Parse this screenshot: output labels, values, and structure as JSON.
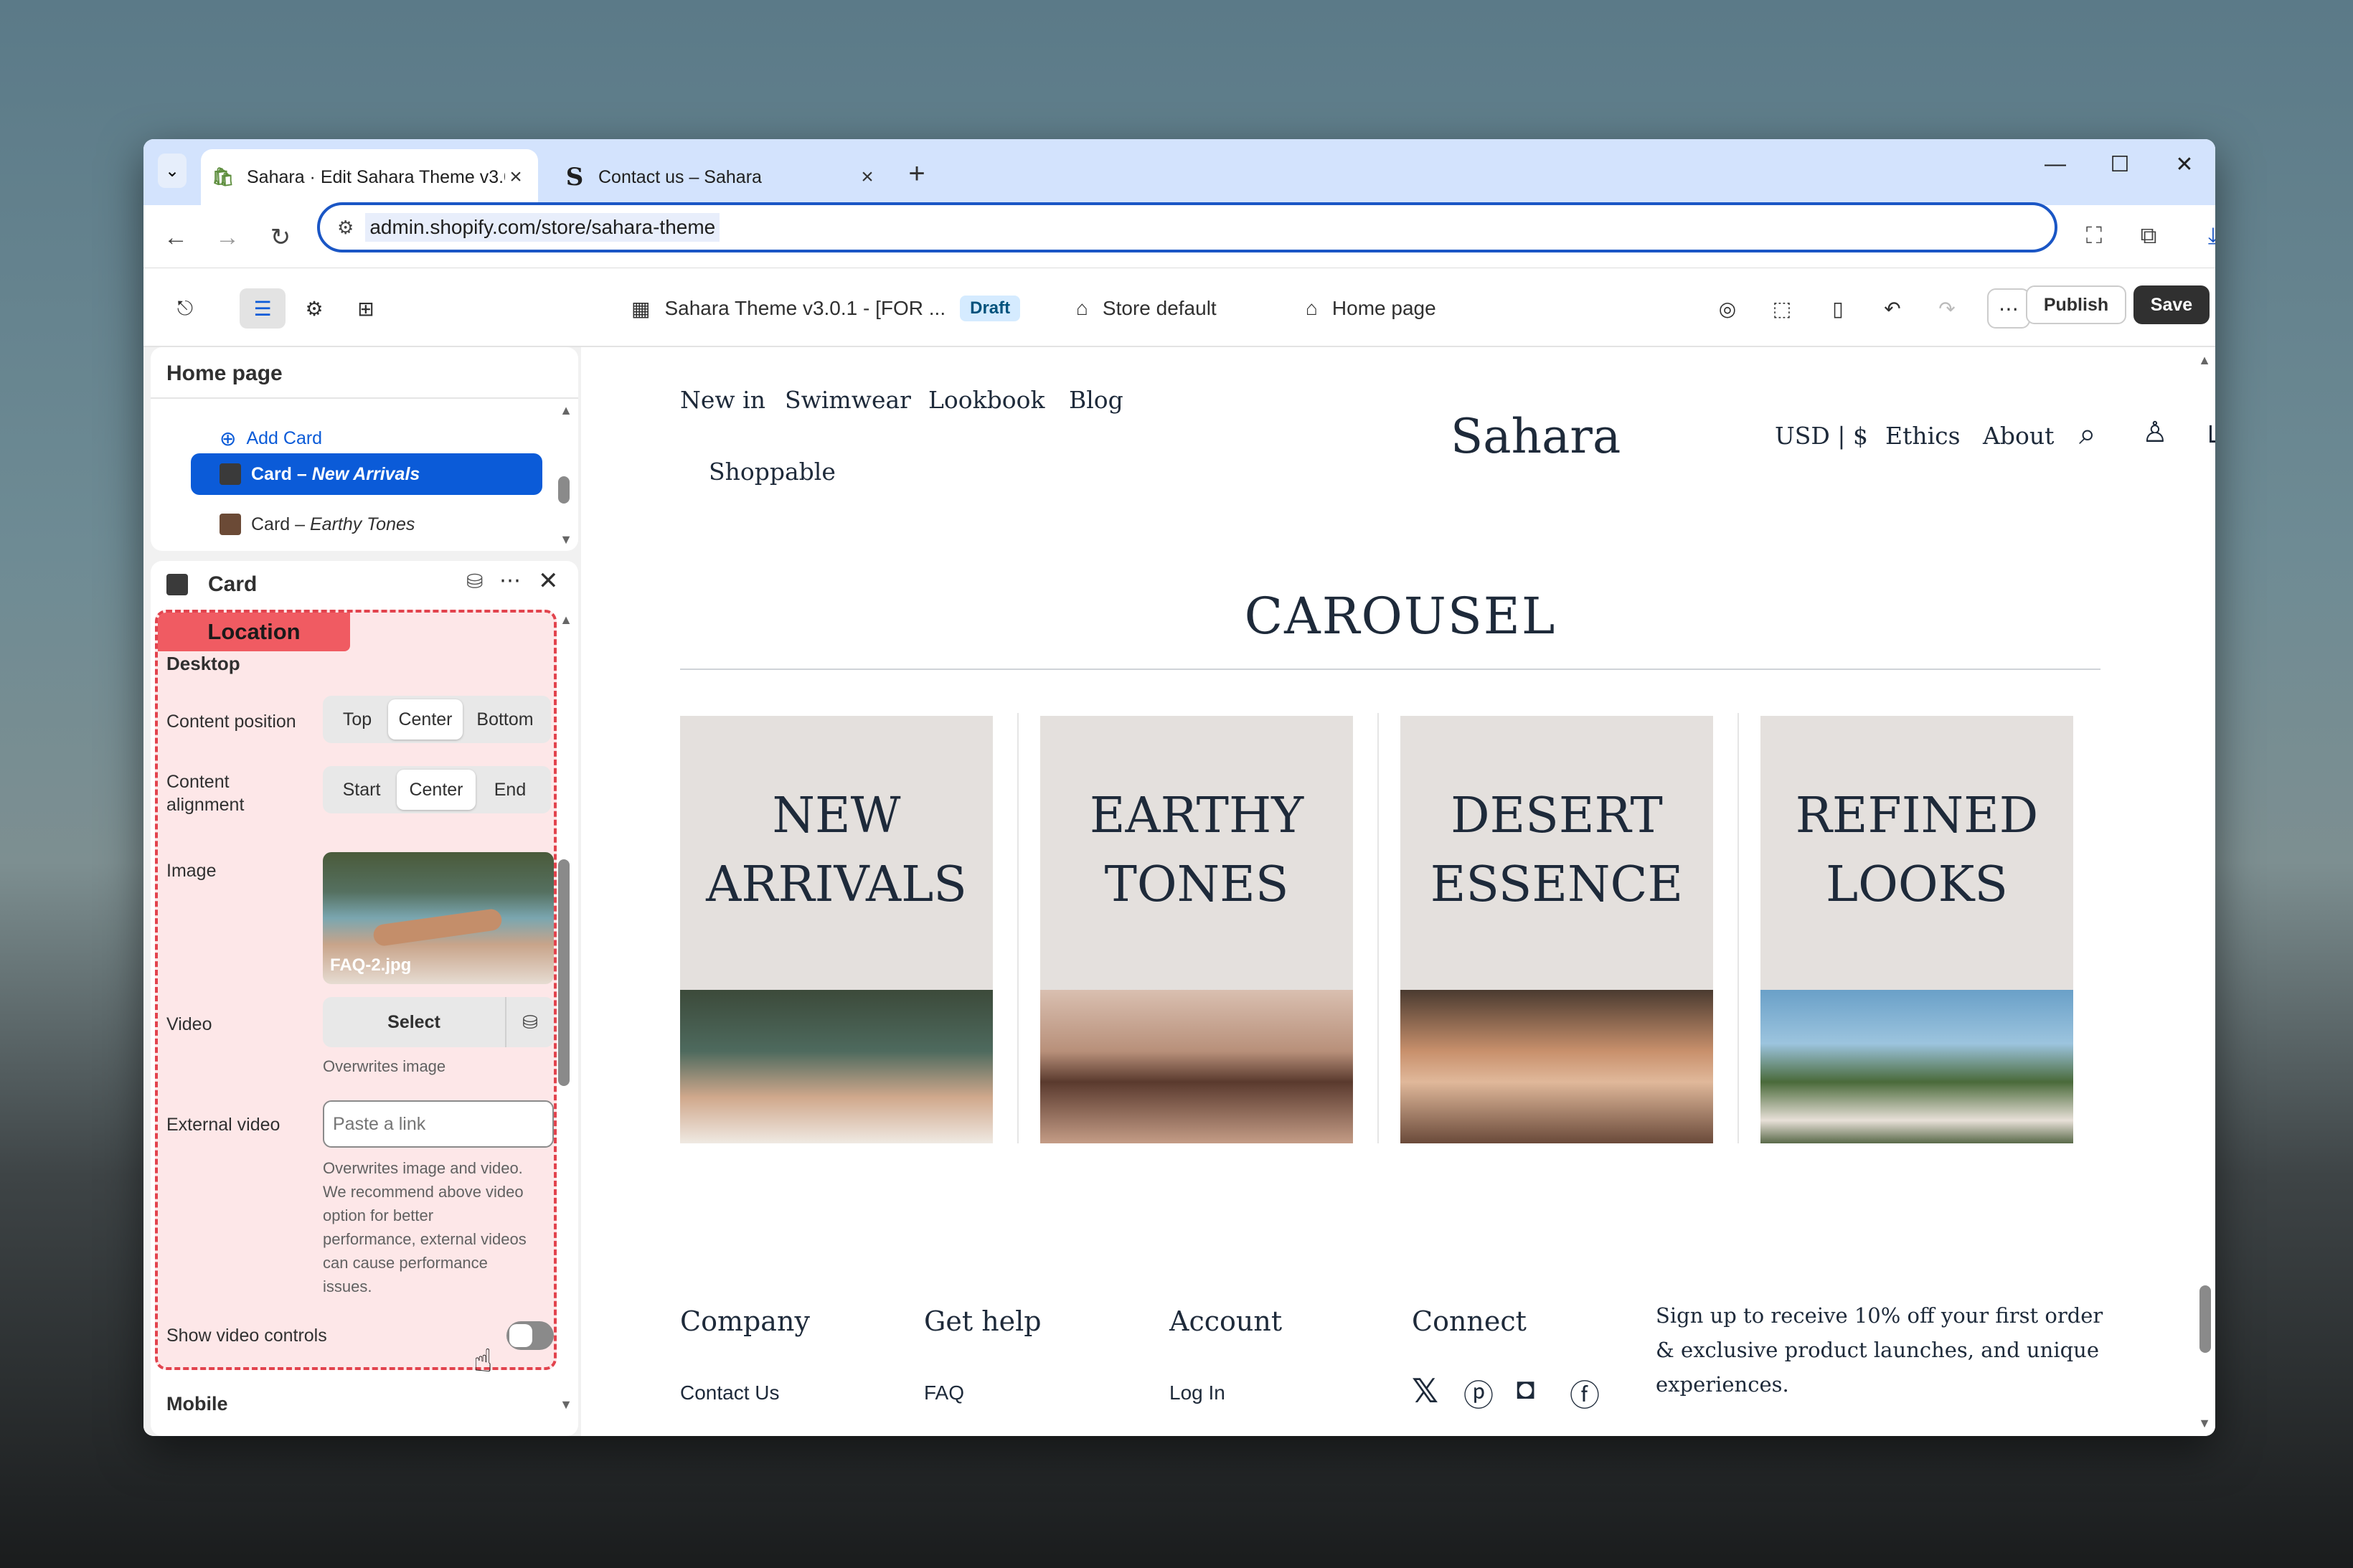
{
  "browser": {
    "tabs": [
      {
        "title": "Sahara · Edit Sahara Theme v3.0",
        "active": true
      },
      {
        "title": "Contact us – Sahara",
        "active": false
      }
    ],
    "url": "admin.shopify.com/store/sahara-theme"
  },
  "editor": {
    "theme_title": "Sahara Theme v3.0.1 - [FOR ...",
    "status": "Draft",
    "store": "Store default",
    "page": "Home page",
    "publish_label": "Publish",
    "save_label": "Save"
  },
  "sidebar": {
    "section_title": "Home page",
    "add_card": "Add Card",
    "items": [
      {
        "prefix": "Card – ",
        "name": "New Arrivals",
        "selected": true
      },
      {
        "prefix": "Card – ",
        "name": "Earthy Tones",
        "selected": false
      }
    ]
  },
  "settings": {
    "title": "Card",
    "location_tag": "Location",
    "desktop_heading": "Desktop",
    "content_position": {
      "label": "Content position",
      "options": [
        "Top",
        "Center",
        "Bottom"
      ],
      "selected": "Center"
    },
    "content_alignment": {
      "label_line1": "Content",
      "label_line2": "alignment",
      "options": [
        "Start",
        "Center",
        "End"
      ],
      "selected": "Center"
    },
    "image": {
      "label": "Image",
      "filename": "FAQ-2.jpg"
    },
    "video": {
      "label": "Video",
      "select_label": "Select",
      "hint": "Overwrites image"
    },
    "external_video": {
      "label": "External video",
      "placeholder": "Paste a link",
      "hint": [
        "Overwrites image and video.",
        "We recommend above video",
        "option for better",
        "performance, external videos",
        "can cause performance",
        "issues."
      ]
    },
    "show_video_controls": {
      "label": "Show video controls",
      "value": false
    },
    "mobile_heading": "Mobile"
  },
  "store": {
    "nav_left": [
      "New in",
      "Swimwear",
      "Lookbook",
      "Blog",
      "Shoppable"
    ],
    "brand": "Sahara",
    "nav_right": [
      "USD | $",
      "Ethics",
      "About"
    ],
    "carousel_title": "CAROUSEL",
    "cards": [
      {
        "line1": "NEW",
        "line2": "ARRIVALS"
      },
      {
        "line1": "EARTHY",
        "line2": "TONES"
      },
      {
        "line1": "DESERT",
        "line2": "ESSENCE"
      },
      {
        "line1": "REFINED",
        "line2": "LOOKS"
      }
    ],
    "footer": {
      "columns": [
        {
          "title": "Company",
          "link": "Contact Us"
        },
        {
          "title": "Get help",
          "link": "FAQ"
        },
        {
          "title": "Account",
          "link": "Log In"
        },
        {
          "title": "Connect",
          "link": ""
        }
      ],
      "newsletter": [
        "Sign up to receive 10% off your first order",
        "& exclusive product launches, and unique",
        "experiences."
      ]
    }
  }
}
